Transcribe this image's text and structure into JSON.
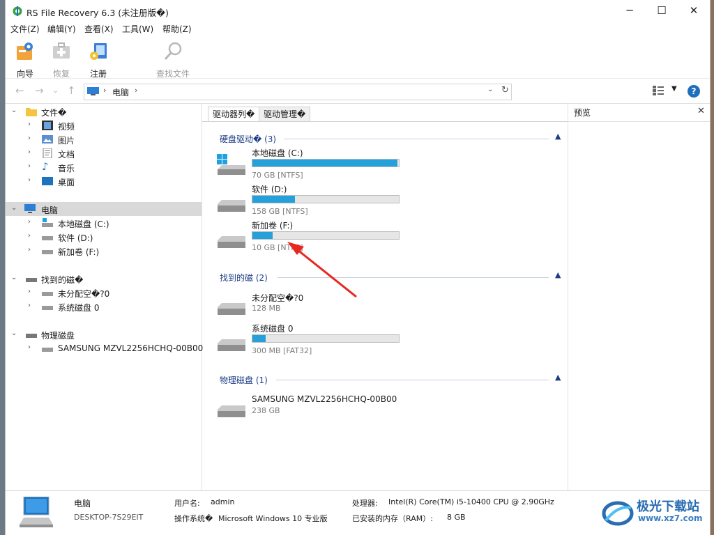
{
  "window": {
    "title": "RS File Recovery 6.3 (未注册版�)",
    "minimize": "─",
    "maximize": "☐",
    "close": "✕"
  },
  "menu": [
    "文件(Z)",
    "编辑(Y)",
    "查看(X)",
    "工具(W)",
    "帮助(Z)"
  ],
  "toolbar": {
    "wizard": "向导",
    "restore": "恢复",
    "register": "注册",
    "find": "查找文件"
  },
  "address": {
    "back": "←",
    "forward": "→",
    "dropdown": "⌄",
    "up": "↑",
    "crumb_sep": "›",
    "path": "电脑",
    "path_sep": "›"
  },
  "tree": {
    "folders_root": "文件�",
    "folders": [
      "视频",
      "图片",
      "文档",
      "音乐",
      "桌面"
    ],
    "computer": "电脑",
    "computer_children": [
      "本地磁盘 (C:)",
      "软件 (D:)",
      "新加卷 (F:)"
    ],
    "found_root": "找到的磁�",
    "found_children": [
      "未分配空�?0",
      "系统磁盘 0"
    ],
    "physical_root": "物理磁盘",
    "physical_children": [
      "SAMSUNG MZVL2256HCHQ-00B00"
    ]
  },
  "tabs": [
    "驱动器列�",
    "驱动管理�"
  ],
  "groups": {
    "hdd": {
      "title": "硬盘驱动� (3)",
      "drives": [
        {
          "name": "本地磁盘 (C:)",
          "size": "70 GB [NTFS]",
          "used": 0.99
        },
        {
          "name": "软件 (D:)",
          "size": "158 GB [NTFS]",
          "used": 0.29
        },
        {
          "name": "新加卷 (F:)",
          "size": "10 GB [NTFS]",
          "used": 0.14
        }
      ]
    },
    "found": {
      "title": "找到的磁 (2)",
      "drives": [
        {
          "name": "未分配空�?0",
          "size": "128 MB"
        },
        {
          "name": "系统磁盘 0",
          "size": "300 MB [FAT32]",
          "used": 0.09
        }
      ]
    },
    "physical": {
      "title": "物理磁盘 (1)",
      "drives": [
        {
          "name": "SAMSUNG MZVL2256HCHQ-00B00",
          "size": "238 GB"
        }
      ]
    }
  },
  "preview": {
    "title": "预览",
    "close": "✕"
  },
  "status": {
    "name": "电脑",
    "host": "DESKTOP-7S29EIT",
    "user_label": "用户名:",
    "user": "admin",
    "os_label": "操作系统�",
    "os": "Microsoft Windows 10 专业版",
    "cpu_label": "处理器:",
    "cpu": "Intel(R) Core(TM) i5-10400 CPU @ 2.90GHz",
    "ram_label": "已安装的内存（RAM）:",
    "ram": "8 GB"
  },
  "watermark": {
    "text": "极光下载站",
    "url": "www.xz7.com"
  },
  "colors": {
    "bar": "#26a0da",
    "group_title": "#1d3c86",
    "arrow": "#e8271f"
  }
}
